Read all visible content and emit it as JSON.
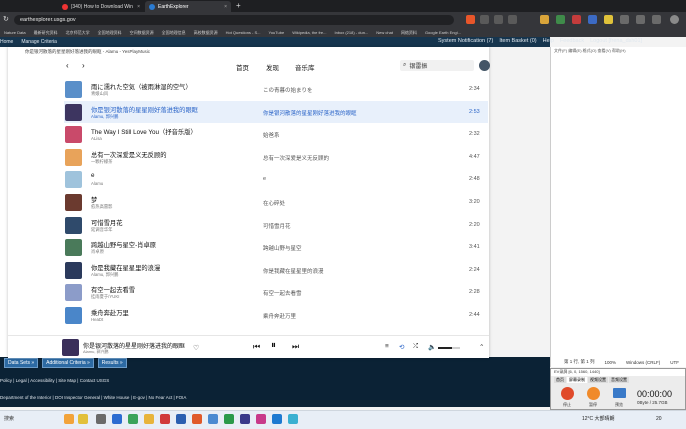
{
  "browser": {
    "tabs": [
      {
        "label": "(340) How to Download Wind...",
        "active": false
      },
      {
        "label": "EarthExplorer",
        "active": true
      }
    ],
    "url": "earthexplorer.usgs.gov",
    "bookmarks": [
      "Nature Data",
      "最新研究资料",
      "北京师范大学",
      "全国地理资料",
      "空间数据资源",
      "全国地理信息",
      "高校数据资源",
      "Hot Questions - S...",
      "YouTube",
      "Wikipedia, the fre...",
      "Inbox (218) - dun...",
      "New chat",
      "网络资料",
      "Google Earth Engi..."
    ]
  },
  "usgs": {
    "left_menu": [
      "Home",
      "Manage Criteria"
    ],
    "right_menu": [
      "System Notification (7)",
      "Item Basket (0)",
      "Help",
      "Feedback",
      "Logout [frena_dsh01]"
    ],
    "buttons": [
      "Data Sets »",
      "Additional Criteria »",
      "Results »"
    ],
    "footer1": "Policy | Legal | Accessibility | Site Map | Contact USGS",
    "footer2": "Department of the Interior | DOI Inspector General | White House | E-gov | No Fear Act | FOIA"
  },
  "rightdoc": {
    "header": "文件(F) 编辑(E) 格式(O) 查看(V) 帮助(H)",
    "status": [
      "第 1 行, 第 1 列",
      "100%",
      "Windows (CRLF)",
      "UTF"
    ]
  },
  "music": {
    "window_title": "你是银河散落的星星刚好落进我的眼眶 - Alamu - YesPlayMusic",
    "nav": [
      "首页",
      "发现",
      "音乐库"
    ],
    "search_value": "银雷振",
    "songs": [
      {
        "title": "雨に濡れた空気（被雨淋湿的空气）",
        "artist": "青娘山风",
        "album": "この青暮の始まりを",
        "duration": "2:34",
        "selected": false,
        "color": "#5a8fc9"
      },
      {
        "title": "你是银河散落的星星刚好落进我的眼眶",
        "artist": "Alamu, 郭兴鹏",
        "album": "你是银河散落的星星刚好落进我的眼眶",
        "duration": "2:53",
        "selected": true,
        "color": "#3d3560"
      },
      {
        "title": "The Way I Still Love You（抒音乐版）",
        "artist": "ALisa",
        "album": "始爸系",
        "duration": "2:32",
        "selected": false,
        "color": "#c94a6a"
      },
      {
        "title": "总有一次深爱是义无反顾的",
        "artist": "一颗柠檬茶",
        "album": "总有一次深爱是义无反顾的",
        "duration": "4:47",
        "selected": false,
        "color": "#e8a35a"
      },
      {
        "title": "e",
        "artist": "Alamu",
        "album": "e",
        "duration": "2:48",
        "selected": false,
        "color": "#9fc3dc"
      },
      {
        "title": "梦",
        "artist": "愈热高雷影",
        "album": "在心碎处",
        "duration": "3:20",
        "selected": false,
        "color": "#6b3a2f"
      },
      {
        "title": "可惜雪月花",
        "artist": "延调音华年",
        "album": "可惜雪月花",
        "duration": "2:20",
        "selected": false,
        "color": "#2f4a6b"
      },
      {
        "title": "跨越山野与星空-肖卓原",
        "artist": "肖卓原",
        "album": "跨越山野与星空",
        "duration": "3:41",
        "selected": false,
        "color": "#4a7a5a"
      },
      {
        "title": "你是我藏在星星里的浪漫",
        "artist": "Alamu, 郭兴鹏",
        "album": "你是我藏在星星里的浪漫",
        "duration": "2:24",
        "selected": false,
        "color": "#2b3a5c"
      },
      {
        "title": "有空一起去看雪",
        "artist": "挂雨夏于/YUKI",
        "album": "有空一起去看雪",
        "duration": "2:28",
        "selected": false,
        "color": "#8c9cc9"
      },
      {
        "title": "乘舟奔赴万里",
        "artist": "HeaDt",
        "album": "乘舟奔赴万里",
        "duration": "2:44",
        "selected": false,
        "color": "#4a86c9"
      }
    ],
    "now_playing": {
      "title": "你是银河散落的星星刚好落进我的眼眶",
      "artist": "Alamu, 郭兴鹏"
    },
    "volume": 0.65
  },
  "recorder": {
    "title": "EV录屏 [6, 0, 1560, 1440]",
    "tabs": [
      "首页",
      "屏幕录制",
      "视频设置",
      "音频设置"
    ],
    "time": "00:00:00",
    "size": "0Byte / 25.7GB",
    "buttons": [
      "停止",
      "暂停",
      "预览"
    ]
  },
  "taskbar": {
    "search": "搜索",
    "weather": "12°C 大部晴朗",
    "time": "20"
  }
}
